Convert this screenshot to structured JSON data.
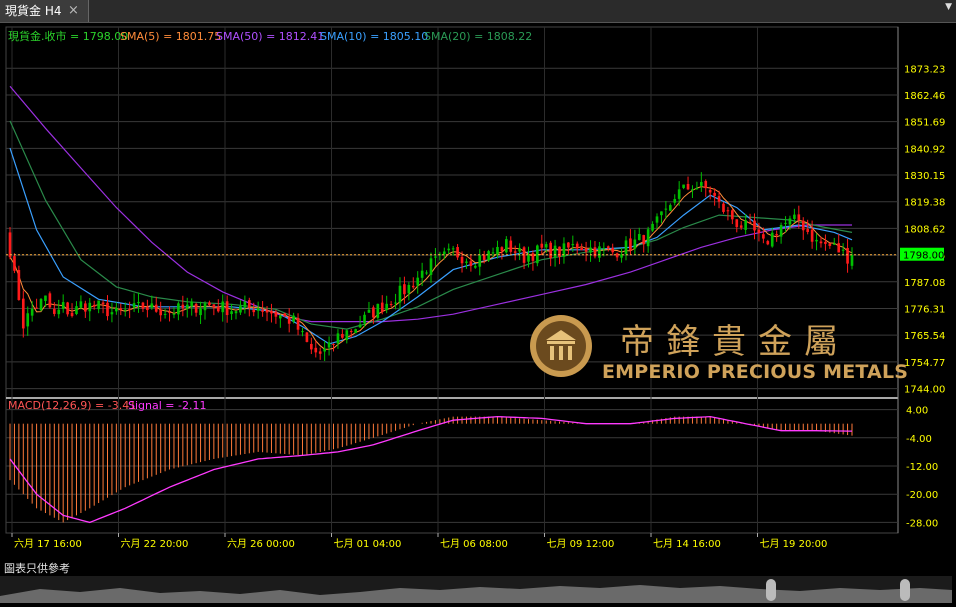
{
  "tab": {
    "label": "現貨金 H4",
    "close": "×",
    "menu_arrow": "▼"
  },
  "legend": {
    "price": "現貨金.收市 = 1798.00",
    "sma5": "SMA(5) = 1801.75",
    "sma50": "SMA(50) = 1812.41",
    "sma10": "SMA(10) = 1805.10",
    "sma20": "SMA(20) = 1808.22"
  },
  "macd_legend": {
    "macd": "MACD(12,26,9) = -3.41",
    "signal": "Signal = -2.11"
  },
  "last_price_label": "1798.00",
  "note": "圖表只供參考",
  "logo": {
    "en": "EMPERIO PRECIOUS METALS",
    "cn": "帝鋒貴金屬"
  },
  "colors": {
    "up": "#00c000",
    "down": "#ff1a1a",
    "price_label": "#00ff00",
    "sma5": "#ff8c3a",
    "sma10": "#3aa0ff",
    "sma20": "#2a8a4a",
    "sma50": "#9b30e0",
    "macd_hist": "#ff7a3a",
    "signal": "#ff3aff",
    "axis_text": "#ffff00"
  },
  "chart_data": {
    "type": "candlestick",
    "price_axis": {
      "ticks": [
        1873.23,
        1862.46,
        1851.69,
        1840.92,
        1830.15,
        1819.38,
        1808.62,
        1797.85,
        1787.08,
        1776.31,
        1765.54,
        1754.77,
        1744.0
      ],
      "tick_labels": [
        "1873.23",
        "1862.46",
        "1851.69",
        "1840.92",
        "1830.15",
        "1819.38",
        "1808.62",
        "1797.85",
        "1787.08",
        "1776.31",
        "1765.54",
        "1754.77",
        "1744.00"
      ],
      "range": [
        1741,
        1881
      ]
    },
    "macd_axis": {
      "ticks": [
        4,
        -4,
        -12,
        -20,
        -28
      ],
      "tick_labels": [
        "4.00",
        "-4.00",
        "-12.00",
        "-20.00",
        "-28.00"
      ],
      "range": [
        -31,
        7
      ]
    },
    "x_labels": [
      "六月 17 16:00",
      "六月 22 20:00",
      "六月 26 00:00",
      "七月 01 04:00",
      "七月 06 08:00",
      "七月 09 12:00",
      "七月 14 16:00",
      "七月 19 20:00"
    ],
    "price_anchors": [
      [
        0,
        1800
      ],
      [
        1,
        1789
      ],
      [
        2,
        1781
      ],
      [
        3,
        1770
      ],
      [
        5,
        1776
      ],
      [
        8,
        1780
      ],
      [
        10,
        1773
      ],
      [
        12,
        1777
      ],
      [
        14,
        1774
      ],
      [
        16,
        1778
      ],
      [
        20,
        1777
      ],
      [
        24,
        1774
      ],
      [
        30,
        1777
      ],
      [
        36,
        1775
      ],
      [
        44,
        1778
      ],
      [
        50,
        1776
      ],
      [
        56,
        1777
      ],
      [
        60,
        1774
      ],
      [
        64,
        1771
      ],
      [
        66,
        1765
      ],
      [
        68,
        1759
      ],
      [
        70,
        1758
      ],
      [
        72,
        1760
      ],
      [
        74,
        1765
      ],
      [
        78,
        1769
      ],
      [
        82,
        1775
      ],
      [
        86,
        1780
      ],
      [
        90,
        1785
      ],
      [
        94,
        1793
      ],
      [
        98,
        1797
      ],
      [
        100,
        1799
      ],
      [
        104,
        1796
      ],
      [
        108,
        1798
      ],
      [
        112,
        1802
      ],
      [
        116,
        1797
      ],
      [
        120,
        1800
      ],
      [
        124,
        1799
      ],
      [
        128,
        1802
      ],
      [
        132,
        1800
      ],
      [
        136,
        1799
      ],
      [
        140,
        1802
      ],
      [
        144,
        1806
      ],
      [
        148,
        1815
      ],
      [
        150,
        1822
      ],
      [
        154,
        1826
      ],
      [
        158,
        1824
      ],
      [
        160,
        1818
      ],
      [
        164,
        1811
      ],
      [
        168,
        1807
      ],
      [
        170,
        1802
      ],
      [
        174,
        1810
      ],
      [
        178,
        1812
      ],
      [
        182,
        1803
      ],
      [
        186,
        1801
      ],
      [
        190,
        1796
      ]
    ],
    "sma50_anchors": [
      [
        0,
        1866
      ],
      [
        8,
        1849
      ],
      [
        16,
        1833
      ],
      [
        24,
        1817
      ],
      [
        32,
        1803
      ],
      [
        40,
        1791
      ],
      [
        48,
        1783
      ],
      [
        56,
        1777
      ],
      [
        62,
        1773
      ],
      [
        68,
        1771
      ],
      [
        76,
        1771
      ],
      [
        84,
        1771
      ],
      [
        92,
        1772
      ],
      [
        100,
        1774
      ],
      [
        110,
        1778
      ],
      [
        120,
        1782
      ],
      [
        130,
        1786
      ],
      [
        140,
        1791
      ],
      [
        148,
        1796
      ],
      [
        156,
        1801
      ],
      [
        164,
        1805
      ],
      [
        172,
        1808
      ],
      [
        180,
        1810
      ],
      [
        190,
        1810
      ]
    ],
    "sma20_anchors": [
      [
        0,
        1852
      ],
      [
        8,
        1820
      ],
      [
        16,
        1796
      ],
      [
        24,
        1785
      ],
      [
        32,
        1781
      ],
      [
        40,
        1779
      ],
      [
        50,
        1778
      ],
      [
        60,
        1776
      ],
      [
        68,
        1770
      ],
      [
        76,
        1768
      ],
      [
        84,
        1772
      ],
      [
        92,
        1777
      ],
      [
        100,
        1784
      ],
      [
        110,
        1790
      ],
      [
        120,
        1796
      ],
      [
        130,
        1799
      ],
      [
        140,
        1801
      ],
      [
        146,
        1804
      ],
      [
        152,
        1809
      ],
      [
        160,
        1814
      ],
      [
        168,
        1813
      ],
      [
        176,
        1812
      ],
      [
        184,
        1809
      ],
      [
        190,
        1807
      ]
    ],
    "sma10_anchors": [
      [
        0,
        1841
      ],
      [
        6,
        1808
      ],
      [
        12,
        1789
      ],
      [
        20,
        1780
      ],
      [
        30,
        1777
      ],
      [
        40,
        1777
      ],
      [
        50,
        1777
      ],
      [
        60,
        1775
      ],
      [
        66,
        1769
      ],
      [
        72,
        1762
      ],
      [
        78,
        1765
      ],
      [
        84,
        1771
      ],
      [
        92,
        1781
      ],
      [
        100,
        1792
      ],
      [
        110,
        1797
      ],
      [
        120,
        1800
      ],
      [
        130,
        1800
      ],
      [
        140,
        1801
      ],
      [
        146,
        1805
      ],
      [
        152,
        1814
      ],
      [
        158,
        1822
      ],
      [
        164,
        1817
      ],
      [
        170,
        1808
      ],
      [
        178,
        1810
      ],
      [
        186,
        1807
      ],
      [
        190,
        1804
      ]
    ],
    "macd_anchors": [
      [
        0,
        -16
      ],
      [
        6,
        -24
      ],
      [
        12,
        -28
      ],
      [
        18,
        -24
      ],
      [
        26,
        -18
      ],
      [
        36,
        -13
      ],
      [
        46,
        -10
      ],
      [
        56,
        -8
      ],
      [
        66,
        -9
      ],
      [
        74,
        -7
      ],
      [
        82,
        -4
      ],
      [
        92,
        0
      ],
      [
        100,
        2
      ],
      [
        110,
        2
      ],
      [
        120,
        1
      ],
      [
        130,
        0
      ],
      [
        140,
        0
      ],
      [
        150,
        2
      ],
      [
        158,
        2
      ],
      [
        166,
        0
      ],
      [
        174,
        -2
      ],
      [
        182,
        -2
      ],
      [
        190,
        -3.4
      ]
    ],
    "signal_anchors": [
      [
        0,
        -10
      ],
      [
        6,
        -20
      ],
      [
        12,
        -26
      ],
      [
        18,
        -28
      ],
      [
        26,
        -24
      ],
      [
        36,
        -18
      ],
      [
        46,
        -13
      ],
      [
        56,
        -10
      ],
      [
        66,
        -9
      ],
      [
        74,
        -8
      ],
      [
        82,
        -6
      ],
      [
        92,
        -2
      ],
      [
        100,
        1
      ],
      [
        110,
        2
      ],
      [
        120,
        1.5
      ],
      [
        130,
        0
      ],
      [
        140,
        0
      ],
      [
        150,
        1.5
      ],
      [
        158,
        2
      ],
      [
        166,
        0
      ],
      [
        174,
        -2
      ],
      [
        182,
        -2
      ],
      [
        190,
        -2.11
      ]
    ]
  }
}
